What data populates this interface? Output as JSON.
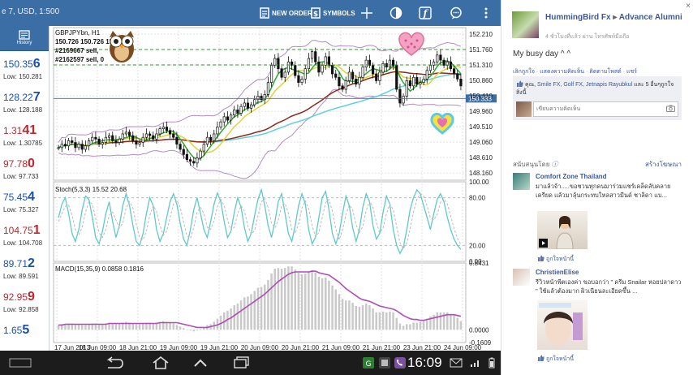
{
  "topbar": {
    "title": "e 7, USD, 1:500",
    "new_order_label": "NEW ORDER",
    "symbols_label": "SYMBOLS",
    "icons": [
      "plus-icon",
      "crosshair-icon",
      "indicators-icon",
      "script-icon",
      "chat-icon",
      "menu-icon"
    ]
  },
  "history_label": "History",
  "quotes": [
    {
      "main": "150.35",
      "big": "6",
      "low": "Low: 150.281",
      "color": "#1a4fb0"
    },
    {
      "main": "128.22",
      "big": "7",
      "low": "Low: 128.188",
      "color": "#1a4fb0"
    },
    {
      "main": "1.31",
      "big": "41",
      "low": "Low: 1.30785",
      "color": "#c0262d"
    },
    {
      "main": "97.78",
      "big": "0",
      "low": "Low: 97.733",
      "color": "#c0262d"
    },
    {
      "main": "75.45",
      "big": "4",
      "low": "Low: 75.327",
      "color": "#1a4fb0"
    },
    {
      "main": "104.75",
      "big": "1",
      "low": "Low: 104.708",
      "color": "#c0262d"
    },
    {
      "main": "89.71",
      "big": "2",
      "low": "Low: 89.591",
      "color": "#1a4fb0"
    },
    {
      "main": "92.95",
      "big": "9",
      "low": "Low: 92.858",
      "color": "#c0262d"
    },
    {
      "main": "1.65",
      "big": "5",
      "low": "",
      "color": "#1a4fb0"
    }
  ],
  "chart": {
    "symbol_label": "GBPJPYbn, H1",
    "ohlc_text": "150.726 150.726 150.333",
    "orders": [
      "#2169667 sell,",
      "#2162597 sell, 0"
    ],
    "current_price": "150.333",
    "price_ticks": [
      "152.210",
      "151.760",
      "151.310",
      "150.860",
      "150.410",
      "149.960",
      "149.510",
      "149.060",
      "148.610",
      "148.160"
    ],
    "price_range": [
      147.95,
      152.4
    ],
    "stoch_label": "Stoch(5,3,3) 15.52 20.68",
    "stoch_ticks": [
      "100.00",
      "80.00",
      "20.00",
      "0.00"
    ],
    "macd_label": "MACD(15,35,9) 0.0858 0.1816",
    "macd_ticks": [
      "0.8431",
      "0.0000",
      "-0.1609"
    ],
    "macd_range": [
      -0.1609,
      0.8431
    ],
    "time_ticks": [
      "17 Jun 2013",
      "18 Jun 09:00",
      "18 Jun 21:00",
      "19 Jun 09:00",
      "19 Jun 21:00",
      "20 Jun 09:00",
      "20 Jun 21:00",
      "21 Jun 09:00",
      "21 Jun 21:00",
      "23 Jun 21:00",
      "24 Jun 09:00"
    ]
  },
  "chart_data": {
    "type": "candlestick",
    "bar_count": 120,
    "close": [
      148.9,
      149,
      148.95,
      149.1,
      149.05,
      148.9,
      149,
      148.85,
      148.95,
      149.1,
      149.2,
      149.15,
      149,
      149.05,
      149.2,
      149.25,
      149.1,
      149.05,
      149.15,
      149.3,
      149.35,
      149.25,
      149.1,
      149,
      149.05,
      149.2,
      149.3,
      149.25,
      149.15,
      149.3,
      149.45,
      149.5,
      149.4,
      149.3,
      149.2,
      149,
      148.85,
      148.7,
      148.55,
      148.5,
      148.45,
      148.6,
      148.8,
      149,
      149.2,
      149.1,
      149.3,
      149.5,
      149.65,
      149.8,
      149.7,
      149.85,
      150,
      149.9,
      150.1,
      150.2,
      150.05,
      150.15,
      150.3,
      150.4,
      150.3,
      150.45,
      150.8,
      151.3,
      151.5,
      151.2,
      150.95,
      151.1,
      151.4,
      151.3,
      151,
      150.8,
      150.9,
      151.2,
      151.5,
      151.7,
      151.4,
      151.1,
      151.3,
      151.55,
      151.3,
      151.05,
      150.95,
      150.7,
      150.6,
      150.85,
      151.1,
      150.9,
      150.75,
      150.95,
      151.25,
      151.45,
      151.3,
      151.05,
      150.85,
      151.1,
      151.35,
      151.25,
      151.45,
      151.3,
      150.6,
      150.2,
      150.4,
      150.85,
      150.7,
      150.95,
      150.75,
      150.8,
      150.9,
      151.15,
      151.3,
      151.4,
      151.6,
      151.45,
      151.3,
      151.4,
      151.2,
      151.05,
      150.9,
      150.7
    ],
    "stochastic_k": [
      55,
      72,
      80,
      60,
      35,
      25,
      40,
      65,
      82,
      78,
      55,
      30,
      22,
      38,
      60,
      75,
      50,
      30,
      45,
      70,
      85,
      70,
      45,
      25,
      20,
      35,
      60,
      80,
      70,
      40,
      25,
      35,
      55,
      75,
      85,
      72,
      48,
      28,
      20,
      40,
      65,
      80,
      60,
      40,
      30,
      50,
      72,
      86,
      75,
      50,
      30,
      38,
      62,
      80,
      68,
      42,
      25,
      35,
      58,
      78,
      90,
      70,
      45,
      30,
      50,
      75,
      85,
      60,
      35,
      25,
      45,
      70,
      85,
      72,
      40,
      22,
      30,
      55,
      80,
      88,
      65,
      35,
      22,
      35,
      60,
      82,
      70,
      42,
      25,
      40,
      68,
      85,
      75,
      45,
      28,
      35,
      62,
      82,
      72,
      40,
      20,
      10,
      18,
      40,
      65,
      80,
      90,
      85,
      70,
      55,
      40,
      60,
      78,
      85,
      75,
      55,
      40,
      28,
      20,
      15
    ],
    "stochastic_d": [
      50,
      60,
      69,
      71,
      58,
      40,
      33,
      43,
      62,
      75,
      72,
      54,
      36,
      30,
      40,
      58,
      62,
      52,
      42,
      48,
      67,
      75,
      67,
      47,
      30,
      27,
      38,
      58,
      70,
      63,
      45,
      33,
      38,
      55,
      72,
      77,
      68,
      49,
      32,
      29,
      42,
      62,
      68,
      60,
      43,
      40,
      51,
      69,
      78,
      70,
      52,
      39,
      43,
      60,
      70,
      63,
      45,
      34,
      39,
      57,
      75,
      79,
      68,
      48,
      42,
      52,
      70,
      73,
      60,
      40,
      35,
      47,
      67,
      76,
      66,
      45,
      31,
      36,
      55,
      74,
      78,
      63,
      41,
      27,
      39,
      59,
      71,
      65,
      46,
      36,
      44,
      64,
      76,
      68,
      49,
      36,
      42,
      60,
      72,
      65,
      44,
      23,
      16,
      23,
      41,
      62,
      78,
      85,
      82,
      70,
      55,
      52,
      59,
      74,
      79,
      72,
      57,
      41,
      29,
      21
    ],
    "macd_histogram": [
      0.06,
      0.07,
      0.07,
      0.08,
      0.08,
      0.07,
      0.07,
      0.06,
      0.06,
      0.07,
      0.08,
      0.08,
      0.07,
      0.07,
      0.08,
      0.09,
      0.08,
      0.08,
      0.08,
      0.09,
      0.1,
      0.09,
      0.08,
      0.07,
      0.07,
      0.08,
      0.09,
      0.09,
      0.08,
      0.09,
      0.1,
      0.11,
      0.1,
      0.09,
      0.08,
      0.06,
      0.04,
      0.02,
      0,
      -0.01,
      -0.02,
      -0.01,
      0.01,
      0.03,
      0.06,
      0.07,
      0.1,
      0.14,
      0.18,
      0.22,
      0.24,
      0.27,
      0.31,
      0.33,
      0.37,
      0.41,
      0.42,
      0.45,
      0.49,
      0.53,
      0.54,
      0.57,
      0.63,
      0.71,
      0.77,
      0.78,
      0.77,
      0.78,
      0.8,
      0.8,
      0.76,
      0.72,
      0.7,
      0.71,
      0.73,
      0.75,
      0.72,
      0.67,
      0.65,
      0.66,
      0.62,
      0.56,
      0.51,
      0.45,
      0.39,
      0.37,
      0.37,
      0.34,
      0.3,
      0.29,
      0.31,
      0.33,
      0.31,
      0.27,
      0.22,
      0.22,
      0.23,
      0.22,
      0.23,
      0.22,
      0.15,
      0.08,
      0.05,
      0.07,
      0.07,
      0.09,
      0.09,
      0.1,
      0.11,
      0.14,
      0.17,
      0.19,
      0.22,
      0.22,
      0.22,
      0.22,
      0.2,
      0.18,
      0.15,
      0.11
    ],
    "macd_signal": [
      0.06,
      0.06,
      0.07,
      0.07,
      0.07,
      0.07,
      0.07,
      0.07,
      0.07,
      0.07,
      0.07,
      0.07,
      0.07,
      0.07,
      0.07,
      0.08,
      0.08,
      0.08,
      0.08,
      0.08,
      0.08,
      0.08,
      0.08,
      0.08,
      0.08,
      0.08,
      0.08,
      0.08,
      0.08,
      0.08,
      0.09,
      0.09,
      0.09,
      0.09,
      0.09,
      0.09,
      0.08,
      0.07,
      0.06,
      0.05,
      0.04,
      0.03,
      0.03,
      0.03,
      0.03,
      0.04,
      0.05,
      0.06,
      0.08,
      0.1,
      0.13,
      0.15,
      0.18,
      0.21,
      0.24,
      0.27,
      0.3,
      0.33,
      0.36,
      0.39,
      0.42,
      0.45,
      0.49,
      0.53,
      0.57,
      0.61,
      0.64,
      0.67,
      0.7,
      0.72,
      0.73,
      0.73,
      0.73,
      0.73,
      0.73,
      0.74,
      0.74,
      0.72,
      0.71,
      0.7,
      0.69,
      0.66,
      0.63,
      0.6,
      0.56,
      0.52,
      0.49,
      0.46,
      0.43,
      0.4,
      0.38,
      0.37,
      0.36,
      0.34,
      0.32,
      0.3,
      0.29,
      0.28,
      0.27,
      0.26,
      0.24,
      0.21,
      0.18,
      0.16,
      0.14,
      0.13,
      0.13,
      0.12,
      0.12,
      0.13,
      0.14,
      0.15,
      0.16,
      0.17,
      0.18,
      0.19,
      0.19,
      0.19,
      0.18,
      0.17
    ]
  },
  "navbar": {
    "clock": "16:09",
    "icons": [
      "back-icon",
      "home-icon",
      "recent-apps-icon",
      "screenshot-icon",
      "up-icon",
      "app-icon",
      "status-icon",
      "viber-icon",
      "mail-icon"
    ]
  },
  "facebook": {
    "close": "×",
    "page_name": "HummingBird Fx",
    "arrow": "▸",
    "group": "Advance Alumni",
    "subtitle": "4 ชั่วโมงที่แล้ว ผ่าน โทรศัพท์มือถือ",
    "post": "My busy day ^ ^",
    "actions": [
      "เลิกถูกใจ",
      "แสดงความคิดเห็น",
      "ติดตามโพสต์",
      "แชร์"
    ],
    "likes_prefix": "คุณ, ",
    "likes_names": "Smile FX, Golf FX, Jetnapis Rayubkul",
    "likes_suffix": " และ 5 อื่นๆถูกใจสิ่งนี้",
    "comment_placeholder": "เขียนความคิดเห็น",
    "sponsored": "สนับสนุนโดย ",
    "create_ad": "สร้างโฆษณา",
    "ads": [
      {
        "name": "Comfort Zone Thailand",
        "desc": "มาแล้วจ้า.....ขอชวนทุกคนมาร่วมแชร์เคล็ดลับคลายเครียด แล้วมาลุ้นกระทบใหลสาวมีนด์ ชาลิดา แบ...",
        "like": "ถูกใจหน้านี้"
      },
      {
        "name": "ChristienElise",
        "desc": "รีวิวหน้าพีตเองค่า ขอบอกว่า \" ครีม Snailar หอยปลาดาว \" ใช้แล้วต้องมาก ผิวเนียนละเอียดขึ้น ...",
        "like": "ถูกใจหน้านี้"
      }
    ]
  }
}
